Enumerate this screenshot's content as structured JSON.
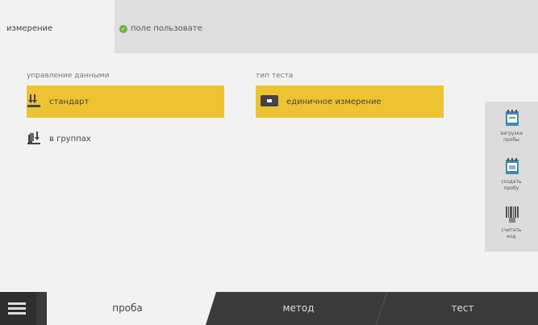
{
  "tabs": {
    "tab1": "измерение",
    "tab2": "поле пользовате"
  },
  "sections": {
    "data_management": {
      "label": "управление данными",
      "items": [
        {
          "label": "стандарт",
          "selected": true
        },
        {
          "label": "в группах",
          "selected": false
        }
      ]
    },
    "test_type": {
      "label": "тип теста",
      "items": [
        {
          "label": "единичное измерение",
          "selected": true
        }
      ]
    }
  },
  "side_buttons": [
    {
      "label_line1": "загрузка",
      "label_line2": "пробы"
    },
    {
      "label_line1": "создать",
      "label_line2": "пробу"
    },
    {
      "label_line1": "считать",
      "label_line2": "код"
    }
  ],
  "bottom_tabs": [
    "проба",
    "метод",
    "тест"
  ],
  "colors": {
    "accent": "#eec332",
    "check": "#6bb33c",
    "bottom": "#3a3a3a"
  }
}
